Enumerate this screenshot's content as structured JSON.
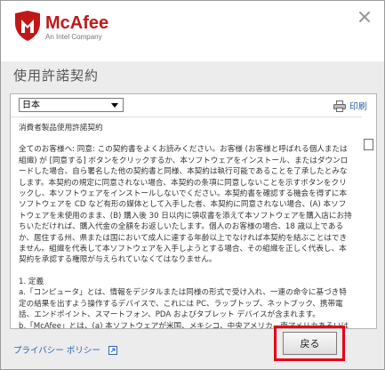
{
  "brand": {
    "name": "McAfee",
    "tagline": "An Intel Company",
    "color": "#c01818"
  },
  "title": "使用許諾契約",
  "language_select": {
    "selected": "日本"
  },
  "print_label": "印刷",
  "document": {
    "paragraphs": [
      "消費者製品使用許諾契約",
      "",
      "全てのお客様へ: 同意: この契約書をよくお読みください。お客様 (お客様と呼ばれる個人または組織) が [同意する] ボタンをクリックするか、本ソフトウェアをインストール、またはダウンロードした場合、自ら署名した他の契約書と同様、本契約は執行可能であることを了承したとみなします。本契約の規定に同意されない場合、本契約の条項に同意しないことを示すボタンをクリックし、本ソフトウェアをインストールしないでください。本契約書を確認する機会を得ずに本ソフトウェアを CD など有形の媒体として入手した者、本契約に同意されない場合、(A) 本ソフトウェアを未使用のまま、(B) 購入後 30 日以内に領収書を添えて本ソフトウェアを購入店にお持ちいただければ、購入代金の全額をお返しいたします。個人のお客様の場合、18 歳以上であるか、居住する州、県または国において成人に達する年齢以上でなければ本契約を結ぶことはできません。組織を代表して本ソフトウェアを入手しようとする場合、その組織を正しく代表し、本契約を承認する権限が与えられていなくてはなりません。",
      "",
      "1. 定義",
      "a.「コンピュータ」とは、情報をデジタルまたは同様の形式で受け入れ、一連の命令に基づき特定の結果を出すよう操作するデバイスで、これには PC、ラップトップ、ネットブック、携帯電話、エンドポイント、スマートフォン、PDA およびタブレット デバイスが含まれます。",
      "b.「McAfee」とは、(a) 本ソフトウェアが米国、メキシコ、中央アメリカ、南アメリカあるいはカリブ海"
    ]
  },
  "privacy_link": "プライバシー ポリシー",
  "back_button": "戻る",
  "highlight_color": "#e60012"
}
